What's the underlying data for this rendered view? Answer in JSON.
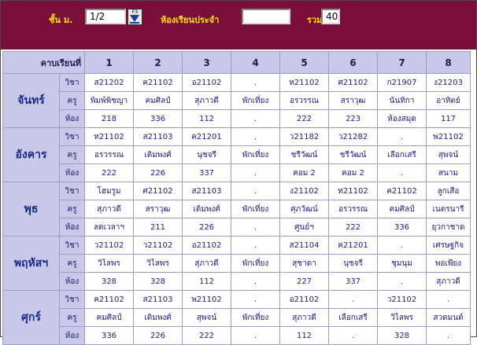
{
  "header": {
    "level_label": "ชั้น ม.",
    "level_value": "1/2",
    "f3_label": "F3",
    "homeroom_label": "ห้องเรียนประจำ",
    "homeroom_value": "",
    "total_label": "รวม",
    "total_value": "40"
  },
  "table": {
    "period_label": "คาบเรียนที่",
    "periods": [
      "1",
      "2",
      "3",
      "4",
      "5",
      "6",
      "7",
      "8"
    ],
    "row_labels": [
      "วิชา",
      "ครู",
      "ห้อง"
    ],
    "days": [
      {
        "name": "จันทร์",
        "slots": [
          [
            "ส21202",
            "พิมพ์พิชญา",
            "218"
          ],
          [
            "ค21102",
            "คมศิลป์",
            "336"
          ],
          [
            "อ21102",
            "สุภาวดี",
            "112"
          ],
          [
            ".",
            "พักเที่ยง",
            "."
          ],
          [
            "ท21102",
            "อรวรรณ",
            "222"
          ],
          [
            "ศ21102",
            "สราวุฒ",
            "223"
          ],
          [
            "ก21907",
            "นันทิกา",
            "ห้องสมุด"
          ],
          [
            "ง21203",
            "อาทิตย์",
            "117"
          ]
        ]
      },
      {
        "name": "อังคาร",
        "slots": [
          [
            "ท21102",
            "อรวรรณ",
            "222"
          ],
          [
            "ส21103",
            "เติมพงศ์",
            "226"
          ],
          [
            "ค21201",
            "นุชจรี",
            "337"
          ],
          [
            ".",
            "พักเที่ยง",
            "."
          ],
          [
            "ว21182",
            "ชรีวัฒน์",
            "คอม 2"
          ],
          [
            "ว21282",
            "ชรีวัฒน์",
            "คอม 2"
          ],
          [
            ".",
            "เลือกเสรี",
            "."
          ],
          [
            "พ21102",
            "สุพจน์",
            "สนาม"
          ]
        ]
      },
      {
        "name": "พุธ",
        "slots": [
          [
            "โฮมรูม",
            "สุภาวดี",
            "ลดเวลาฯ"
          ],
          [
            "ศ21102",
            "สราวุฒ",
            "211"
          ],
          [
            "ส21103",
            "เติมพงศ์",
            "226"
          ],
          [
            ".",
            "พักเที่ยง",
            "."
          ],
          [
            "ง21102",
            "ศุภวัฒน์",
            "ศูนย์ฯ"
          ],
          [
            "ท21102",
            "อรวรรณ",
            "222"
          ],
          [
            "ค21102",
            "คมศิลป์",
            "336"
          ],
          [
            "ลูกเสือ",
            "เนตรนารี",
            "ยุวกาชาด"
          ]
        ]
      },
      {
        "name": "พฤหัสฯ",
        "slots": [
          [
            "ว21102",
            "วิไลพร",
            "328"
          ],
          [
            "ว21102",
            "วิไลพร",
            "328"
          ],
          [
            "อ21102",
            "สุภาวดี",
            "112"
          ],
          [
            ".",
            "พักเที่ยง",
            "."
          ],
          [
            "ส21104",
            "สุชาดา",
            "227"
          ],
          [
            "ค21201",
            "นุชจรี",
            "337"
          ],
          [
            ".",
            "ชุมนุม",
            "."
          ],
          [
            "เศรษฐกิจ",
            "พอเพียง",
            "สุภาวดี"
          ]
        ]
      },
      {
        "name": "ศุกร์",
        "slots": [
          [
            "ค21102",
            "คมศิลป์",
            "336"
          ],
          [
            "ส21103",
            "เติมพงศ์",
            "226"
          ],
          [
            "พ21102",
            "สุพจน์",
            "222"
          ],
          [
            ".",
            "พักเที่ยง",
            "."
          ],
          [
            "อ21102",
            "สุภาวดี",
            "112"
          ],
          [
            ".",
            "เลือกเสรี",
            "."
          ],
          [
            "ว21102",
            "วิไลพร",
            "328"
          ],
          [
            ".",
            "สวดมนต์",
            "."
          ]
        ]
      }
    ]
  }
}
